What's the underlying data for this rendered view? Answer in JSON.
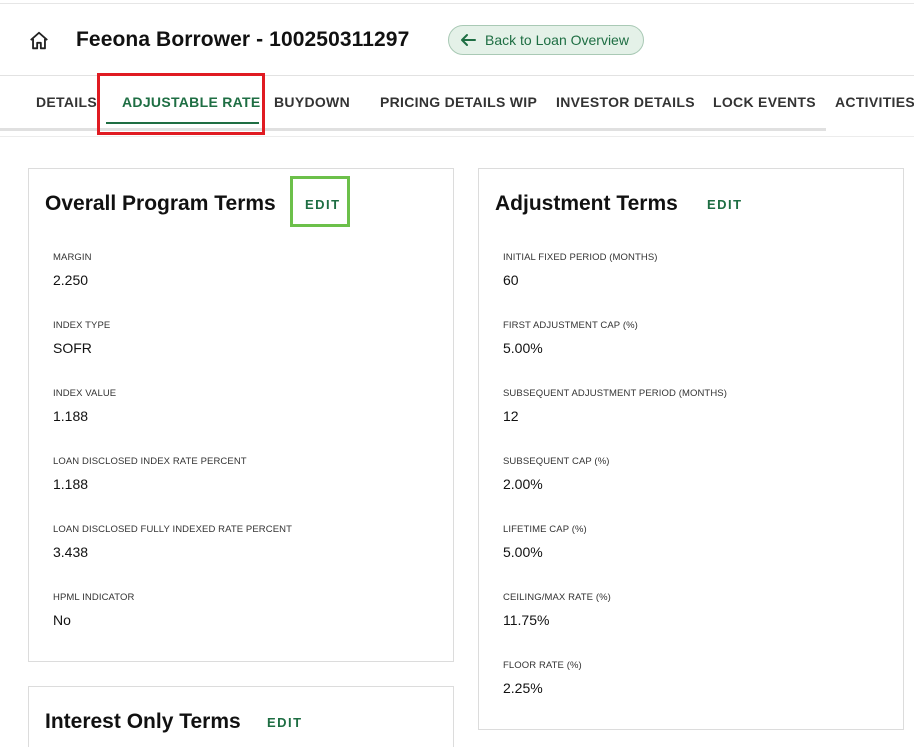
{
  "header": {
    "title": "Feeona Borrower - 100250311297",
    "back_button": "Back to Loan Overview"
  },
  "tabs": [
    {
      "label": "DETAILS"
    },
    {
      "label": "ADJUSTABLE RATE"
    },
    {
      "label": "BUYDOWN"
    },
    {
      "label": "PRICING DETAILS WIP"
    },
    {
      "label": "INVESTOR DETAILS"
    },
    {
      "label": "LOCK EVENTS"
    },
    {
      "label": "ACTIVITIES"
    }
  ],
  "overall_program_terms": {
    "title": "Overall Program Terms",
    "edit": "EDIT",
    "fields": [
      {
        "label": "MARGIN",
        "value": "2.250"
      },
      {
        "label": "INDEX TYPE",
        "value": "SOFR"
      },
      {
        "label": "INDEX VALUE",
        "value": "1.188"
      },
      {
        "label": "LOAN DISCLOSED INDEX RATE PERCENT",
        "value": "1.188"
      },
      {
        "label": "LOAN DISCLOSED FULLY INDEXED RATE PERCENT",
        "value": "3.438"
      },
      {
        "label": "HPML INDICATOR",
        "value": "No"
      }
    ]
  },
  "adjustment_terms": {
    "title": "Adjustment Terms",
    "edit": "EDIT",
    "fields": [
      {
        "label": "INITIAL FIXED PERIOD (MONTHS)",
        "value": "60"
      },
      {
        "label": "FIRST ADJUSTMENT CAP (%)",
        "value": "5.00%"
      },
      {
        "label": "SUBSEQUENT ADJUSTMENT PERIOD (MONTHS)",
        "value": "12"
      },
      {
        "label": "SUBSEQUENT CAP (%)",
        "value": "2.00%"
      },
      {
        "label": "LIFETIME CAP (%)",
        "value": "5.00%"
      },
      {
        "label": "CEILING/MAX RATE (%)",
        "value": "11.75%"
      },
      {
        "label": "FLOOR RATE (%)",
        "value": "2.25%"
      }
    ]
  },
  "interest_only_terms": {
    "title": "Interest Only Terms",
    "edit": "EDIT"
  },
  "colors": {
    "accent_green": "#1e6e43",
    "highlight_red": "#e01b22",
    "highlight_green": "#6cc04a"
  }
}
